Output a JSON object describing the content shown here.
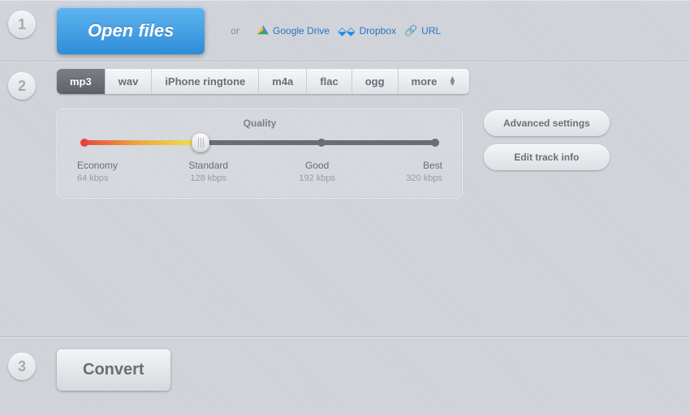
{
  "steps": {
    "s1": "1",
    "s2": "2",
    "s3": "3"
  },
  "open": {
    "label": "Open files",
    "or": "or"
  },
  "sources": {
    "gdrive": "Google Drive",
    "dropbox": "Dropbox",
    "url": "URL"
  },
  "formats": {
    "mp3": "mp3",
    "wav": "wav",
    "ringtone": "iPhone ringtone",
    "m4a": "m4a",
    "flac": "flac",
    "ogg": "ogg",
    "more": "more"
  },
  "quality": {
    "title": "Quality",
    "levels": [
      {
        "name": "Economy",
        "rate": "64 kbps"
      },
      {
        "name": "Standard",
        "rate": "128 kbps"
      },
      {
        "name": "Good",
        "rate": "192 kbps"
      },
      {
        "name": "Best",
        "rate": "320 kbps"
      }
    ],
    "selected_index": 1
  },
  "side": {
    "advanced": "Advanced settings",
    "trackinfo": "Edit track info"
  },
  "convert": "Convert"
}
